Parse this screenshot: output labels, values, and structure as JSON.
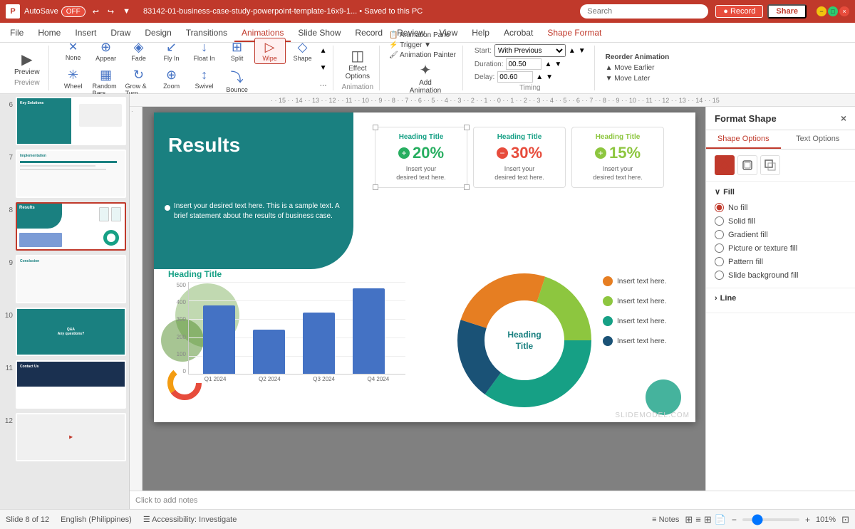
{
  "titleBar": {
    "logo": "P",
    "autosave": "AutoSave",
    "autosaveState": "OFF",
    "fileName": "83142-01-business-case-study-powerpoint-template-16x9-1... • Saved to this PC",
    "search": "Search",
    "record": "● Record",
    "share": "Share"
  },
  "tabs": {
    "items": [
      "File",
      "Home",
      "Insert",
      "Draw",
      "Design",
      "Transitions",
      "Animations",
      "Slide Show",
      "Record",
      "Review",
      "View",
      "Help",
      "Acrobat",
      "Shape Format"
    ]
  },
  "activeTab": "Animations",
  "ribbon": {
    "preview": "Preview",
    "animations": {
      "none": "None",
      "appear": "Appear",
      "fade": "Fade",
      "flyIn": "Fly In",
      "floatIn": "Float In",
      "split": "Split",
      "wipe": "Wipe",
      "shape": "Shape",
      "wheel": "Wheel",
      "randomBars": "Random Bars",
      "growTurn": "Grow & Turn",
      "zoom": "Zoom",
      "swivel": "Swivel",
      "bounce": "Bounce"
    },
    "effectOptions": "Effect\nOptions",
    "addAnimation": "Add\nAnimation",
    "advancedAnimation": {
      "animationPane": "Animation Pane",
      "trigger": "Trigger",
      "animationPainter": "Animation Painter"
    },
    "timing": {
      "start": "Start:",
      "startVal": "With Previous",
      "duration": "Duration:",
      "durationVal": "00.50",
      "delay": "Delay:",
      "delayVal": "00.60"
    },
    "reorder": {
      "title": "Reorder Animation",
      "moveEarlier": "▲ Move Earlier",
      "moveLater": "▼ Move Later"
    }
  },
  "slidePanel": {
    "slides": [
      {
        "num": "6",
        "active": false
      },
      {
        "num": "7",
        "active": false
      },
      {
        "num": "8",
        "active": true
      },
      {
        "num": "9",
        "active": false
      },
      {
        "num": "10",
        "active": false
      },
      {
        "num": "11",
        "active": false
      },
      {
        "num": "12",
        "active": false
      }
    ]
  },
  "slide8": {
    "title": "Results",
    "bodyText": "Insert your desired text here. This is a sample text. A brief statement about the results of business case.",
    "stats": [
      {
        "heading": "Heading Title",
        "icon": "+",
        "value": "20%",
        "color": "green",
        "subtext": "Insert your\ndesired text here."
      },
      {
        "heading": "Heading Title",
        "icon": "−",
        "value": "30%",
        "color": "red",
        "subtext": "Insert your\ndesired text here."
      },
      {
        "heading": "Heading Title",
        "icon": "+",
        "value": "15%",
        "color": "olive",
        "subtext": "Insert your\ndesired text here."
      }
    ],
    "chartTitle": "Heading Title",
    "chartData": {
      "labels": [
        "Q1 2024",
        "Q2 2024",
        "Q3 2024",
        "Q4 2024"
      ],
      "values": [
        370,
        240,
        330,
        460
      ],
      "max": 500
    },
    "donut": {
      "centerText": "Heading\nTitle",
      "segments": [
        {
          "color": "#e67e22",
          "pct": 25
        },
        {
          "color": "#8dc63f",
          "pct": 20
        },
        {
          "color": "#16a085",
          "pct": 35
        },
        {
          "color": "#1a5276",
          "pct": 20
        }
      ],
      "legend": [
        {
          "color": "#e67e22",
          "text": "Insert text here."
        },
        {
          "color": "#8dc63f",
          "text": "Insert text here."
        },
        {
          "color": "#16a085",
          "text": "Insert text here."
        },
        {
          "color": "#1a5276",
          "text": "Insert text here."
        }
      ]
    }
  },
  "formatPanel": {
    "title": "Format Shape",
    "tabs": [
      "Shape Options",
      "Text Options"
    ],
    "activeTab": "Shape Options",
    "icons": [
      "pentagon",
      "rect",
      "grid"
    ],
    "fill": {
      "label": "Fill",
      "options": [
        "No fill",
        "Solid fill",
        "Gradient fill",
        "Picture or texture fill",
        "Pattern fill",
        "Slide background fill"
      ],
      "selected": "No fill"
    },
    "line": {
      "label": "Line"
    }
  },
  "statusBar": {
    "slide": "Slide 8 of 12",
    "language": "English (Philippines)",
    "accessibility": "☰ Accessibility: Investigate",
    "notes": "≡ Notes",
    "viewIcons": [
      "normal",
      "outline",
      "slide-sorter",
      "notes-page"
    ],
    "zoom": "101%"
  },
  "notesBar": {
    "placeholder": "Click to add notes"
  },
  "watermark": "SLIDEMODEL.COM"
}
